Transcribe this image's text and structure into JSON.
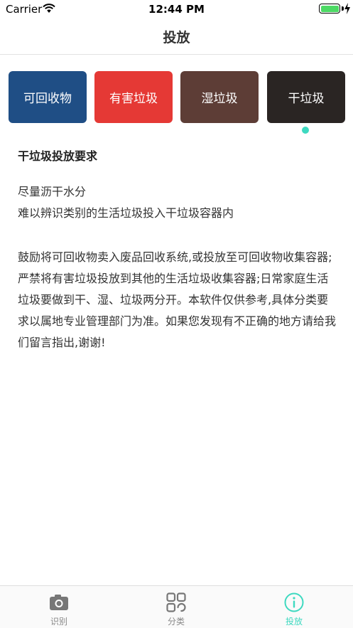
{
  "status_bar": {
    "carrier": "Carrier",
    "time": "12:44 PM",
    "battery_level": 1.0
  },
  "nav": {
    "title": "投放"
  },
  "categories": [
    {
      "label": "可回收物",
      "color": "#1f4e85",
      "selected": false
    },
    {
      "label": "有害垃圾",
      "color": "#e53935",
      "selected": false
    },
    {
      "label": "湿垃圾",
      "color": "#5d3d36",
      "selected": false
    },
    {
      "label": "干垃圾",
      "color": "#2a2523",
      "selected": true
    }
  ],
  "accent_color": "#3ed9c0",
  "content": {
    "title": "干垃圾投放要求",
    "requirements": [
      "尽量沥干水分",
      "难以辨识类别的生活垃圾投入干垃圾容器内"
    ],
    "note": "鼓励将可回收物卖入废品回收系统,或投放至可回收物收集容器;严禁将有害垃圾投放到其他的生活垃圾收集容器;日常家庭生活垃圾要做到干、湿、垃圾两分开。本软件仅供参考,具体分类要求以属地专业管理部门为准。如果您发现有不正确的地方请给我们留言指出,谢谢!"
  },
  "tabs": [
    {
      "label": "识别",
      "icon": "camera-icon",
      "active": false
    },
    {
      "label": "分类",
      "icon": "grid-icon",
      "active": false
    },
    {
      "label": "投放",
      "icon": "info-icon",
      "active": true
    }
  ],
  "tab_colors": {
    "active": "#3ed9c0",
    "inactive": "#888888"
  }
}
